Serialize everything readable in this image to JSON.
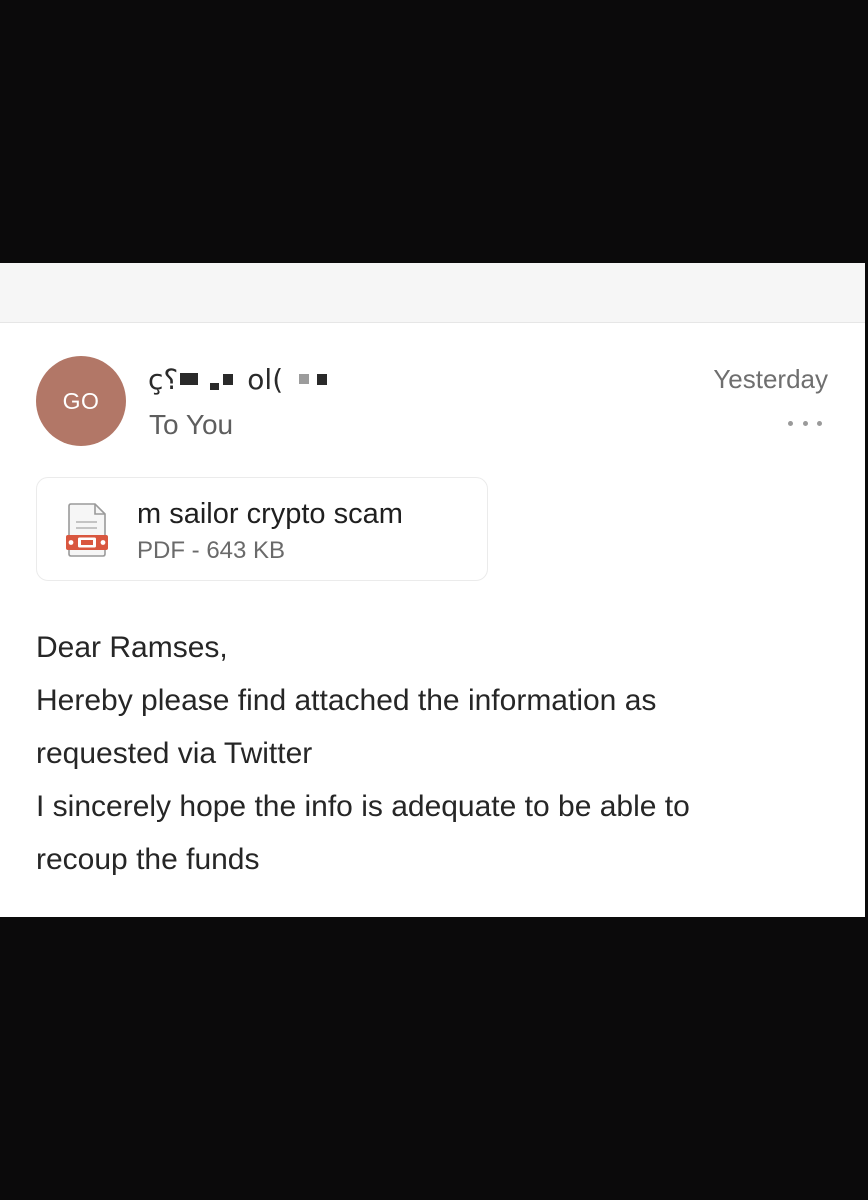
{
  "email": {
    "avatar_initials": "GO",
    "sender_visible_fragments": [
      "ç؟",
      "ol("
    ],
    "recipient": "To You",
    "date": "Yesterday",
    "more_label": "..."
  },
  "attachment": {
    "name": "m sailor crypto scam",
    "meta": "PDF - 643 KB",
    "icon": "pdf-file-icon"
  },
  "body": {
    "lines": [
      "Dear Ramses,",
      "Hereby please find attached the information as",
      "requested via Twitter",
      "I sincerely hope the info is adequate to be able to",
      "recoup the funds"
    ]
  },
  "colors": {
    "frame_background": "#0b0a0b",
    "panel_background": "#ffffff",
    "avatar_background": "#b27767",
    "pdf_accent": "#d9573f"
  }
}
